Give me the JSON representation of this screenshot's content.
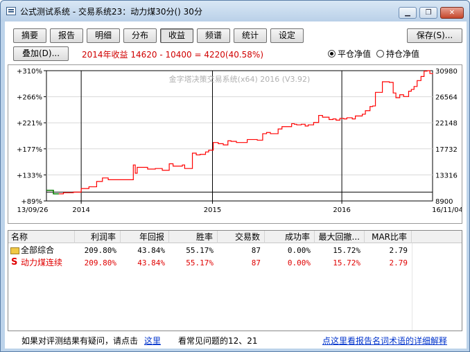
{
  "window": {
    "title": "公式测试系统 - 交易系统23：动力煤30分() 30分",
    "minimize": "▁",
    "restore": "❐",
    "close": "✕"
  },
  "toolbar": {
    "tabs": [
      "摘要",
      "报告",
      "明细",
      "分布",
      "收益",
      "频谱",
      "统计",
      "设定"
    ],
    "active_tab": "收益",
    "save_label": "保存(S)...",
    "overlay_label": "叠加(D)...",
    "summary_text": "2014年收益 14620 - 10400 = 4220(40.58%)",
    "radio_flat": "平仓净值",
    "radio_hold": "持仓净值",
    "radio_selected": "平仓净值"
  },
  "chart_data": {
    "type": "line",
    "watermark": "金字塔决策交易系统(x64) 2016 (V3.92)",
    "left_ticks": [
      "+310%",
      "+266%",
      "+221%",
      "+177%",
      "+133%",
      "+89%"
    ],
    "right_ticks": [
      "30980",
      "26564",
      "22148",
      "17732",
      "13316",
      "8900"
    ],
    "x_labels": [
      "13/09/26",
      "2014",
      "2015",
      "2016",
      "16/11/04"
    ],
    "ylim": [
      8900,
      30980
    ],
    "xlim": [
      0,
      1000
    ],
    "baseline": 10400,
    "grid": true,
    "colors": {
      "line": "#ff0000",
      "grid": "#d8d8d8",
      "baseline": "#000000",
      "start": "#008000"
    },
    "series": [
      {
        "x": [
          0,
          18,
          32,
          44,
          70,
          90,
          110,
          130,
          145,
          160,
          175,
          195,
          225,
          230,
          235,
          248,
          262,
          274,
          282,
          292,
          300,
          318,
          328,
          345,
          352,
          358,
          368,
          378,
          388,
          398,
          404,
          412,
          420,
          432,
          445,
          458,
          470,
          478,
          492,
          500,
          520,
          534,
          546,
          560,
          570,
          580,
          590,
          600,
          610,
          625,
          635,
          642,
          648,
          660,
          670,
          678,
          692,
          705,
          715,
          722,
          732,
          742,
          750,
          760,
          770,
          778,
          792,
          800,
          818,
          826,
          838,
          845,
          852,
          870,
          888,
          898,
          905,
          915,
          925,
          938,
          945,
          952,
          960,
          970,
          978,
          986,
          993,
          1000
        ],
        "values": [
          10700,
          10100,
          10100,
          10300,
          10400,
          11000,
          11300,
          12200,
          12800,
          12500,
          12500,
          12500,
          15000,
          13600,
          14600,
          14600,
          14300,
          14300,
          14400,
          14400,
          14100,
          15200,
          14800,
          14800,
          15000,
          14400,
          14400,
          17000,
          16700,
          16800,
          16800,
          17200,
          17500,
          18800,
          18600,
          18400,
          19100,
          19000,
          18800,
          18800,
          19300,
          19300,
          19200,
          20300,
          20500,
          20300,
          20300,
          21100,
          21500,
          21500,
          22000,
          21900,
          21800,
          21900,
          21600,
          21800,
          22200,
          23400,
          23100,
          23100,
          22700,
          22800,
          22600,
          22900,
          22800,
          23000,
          22800,
          23300,
          23600,
          24200,
          24900,
          25000,
          27300,
          29100,
          29000,
          27200,
          26400,
          26900,
          26600,
          27500,
          27800,
          28300,
          29300,
          30000,
          30900,
          30980,
          30500,
          30400
        ]
      }
    ]
  },
  "table": {
    "headers": [
      "名称",
      "利润率",
      "年回报",
      "胜率",
      "交易数",
      "成功率",
      "最大回撤...",
      "MAR比率"
    ],
    "rows": [
      {
        "icon": "folder",
        "cells": [
          "全部综合",
          "209.80%",
          "43.84%",
          "55.17%",
          "87",
          "0.00%",
          "15.72%",
          "2.79"
        ],
        "color": "#000000"
      },
      {
        "icon": "S",
        "cells": [
          "动力煤连续",
          "209.80%",
          "43.84%",
          "55.17%",
          "87",
          "0.00%",
          "15.72%",
          "2.79"
        ],
        "color": "#e00000"
      }
    ]
  },
  "footer": {
    "question_text": "如果对评测结果有疑问，请点击",
    "here_link": "这里",
    "faq_text": "看常见问题的12、21",
    "glossary_link": "点这里看报告名词术语的详细解释"
  }
}
